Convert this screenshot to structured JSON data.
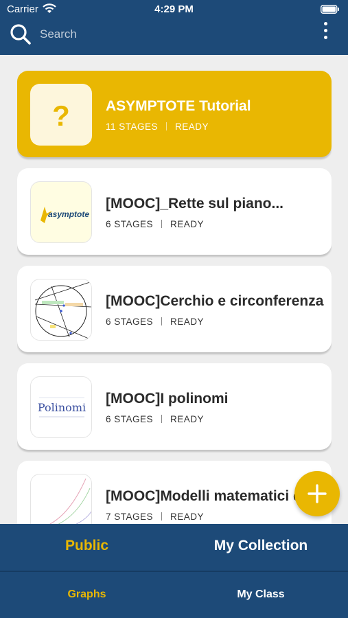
{
  "status": {
    "carrier": "Carrier",
    "time": "4:29 PM"
  },
  "search": {
    "placeholder": "Search"
  },
  "icons": {
    "wifi": "wifi-icon",
    "battery": "battery-icon",
    "search": "search-icon",
    "menu": "more-vertical-icon",
    "add": "plus-icon",
    "tutorial": "question-mark-icon"
  },
  "colors": {
    "header": "#1d4a78",
    "accent": "#e9b702",
    "background": "#eeeeee"
  },
  "graphs": [
    {
      "title": "ASYMPTOTE Tutorial",
      "stages": "11 STAGES",
      "status": "READY",
      "featured": true,
      "thumb": "?"
    },
    {
      "title": "[MOOC]_Rette sul piano...",
      "stages": "6 STAGES",
      "status": "READY",
      "thumb": "asymptote"
    },
    {
      "title": "[MOOC]Cerchio e circonferenza",
      "stages": "6 STAGES",
      "status": "READY"
    },
    {
      "title": "[MOOC]I polinomi",
      "stages": "6 STAGES",
      "status": "READY",
      "thumb": "Polinomi"
    },
    {
      "title": "[MOOC]Modelli matematici di...",
      "stages": "7 STAGES",
      "status": "READY"
    }
  ],
  "segments": {
    "public": "Public",
    "my_collection": "My Collection"
  },
  "tabs": {
    "graphs": "Graphs",
    "my_class": "My Class"
  }
}
